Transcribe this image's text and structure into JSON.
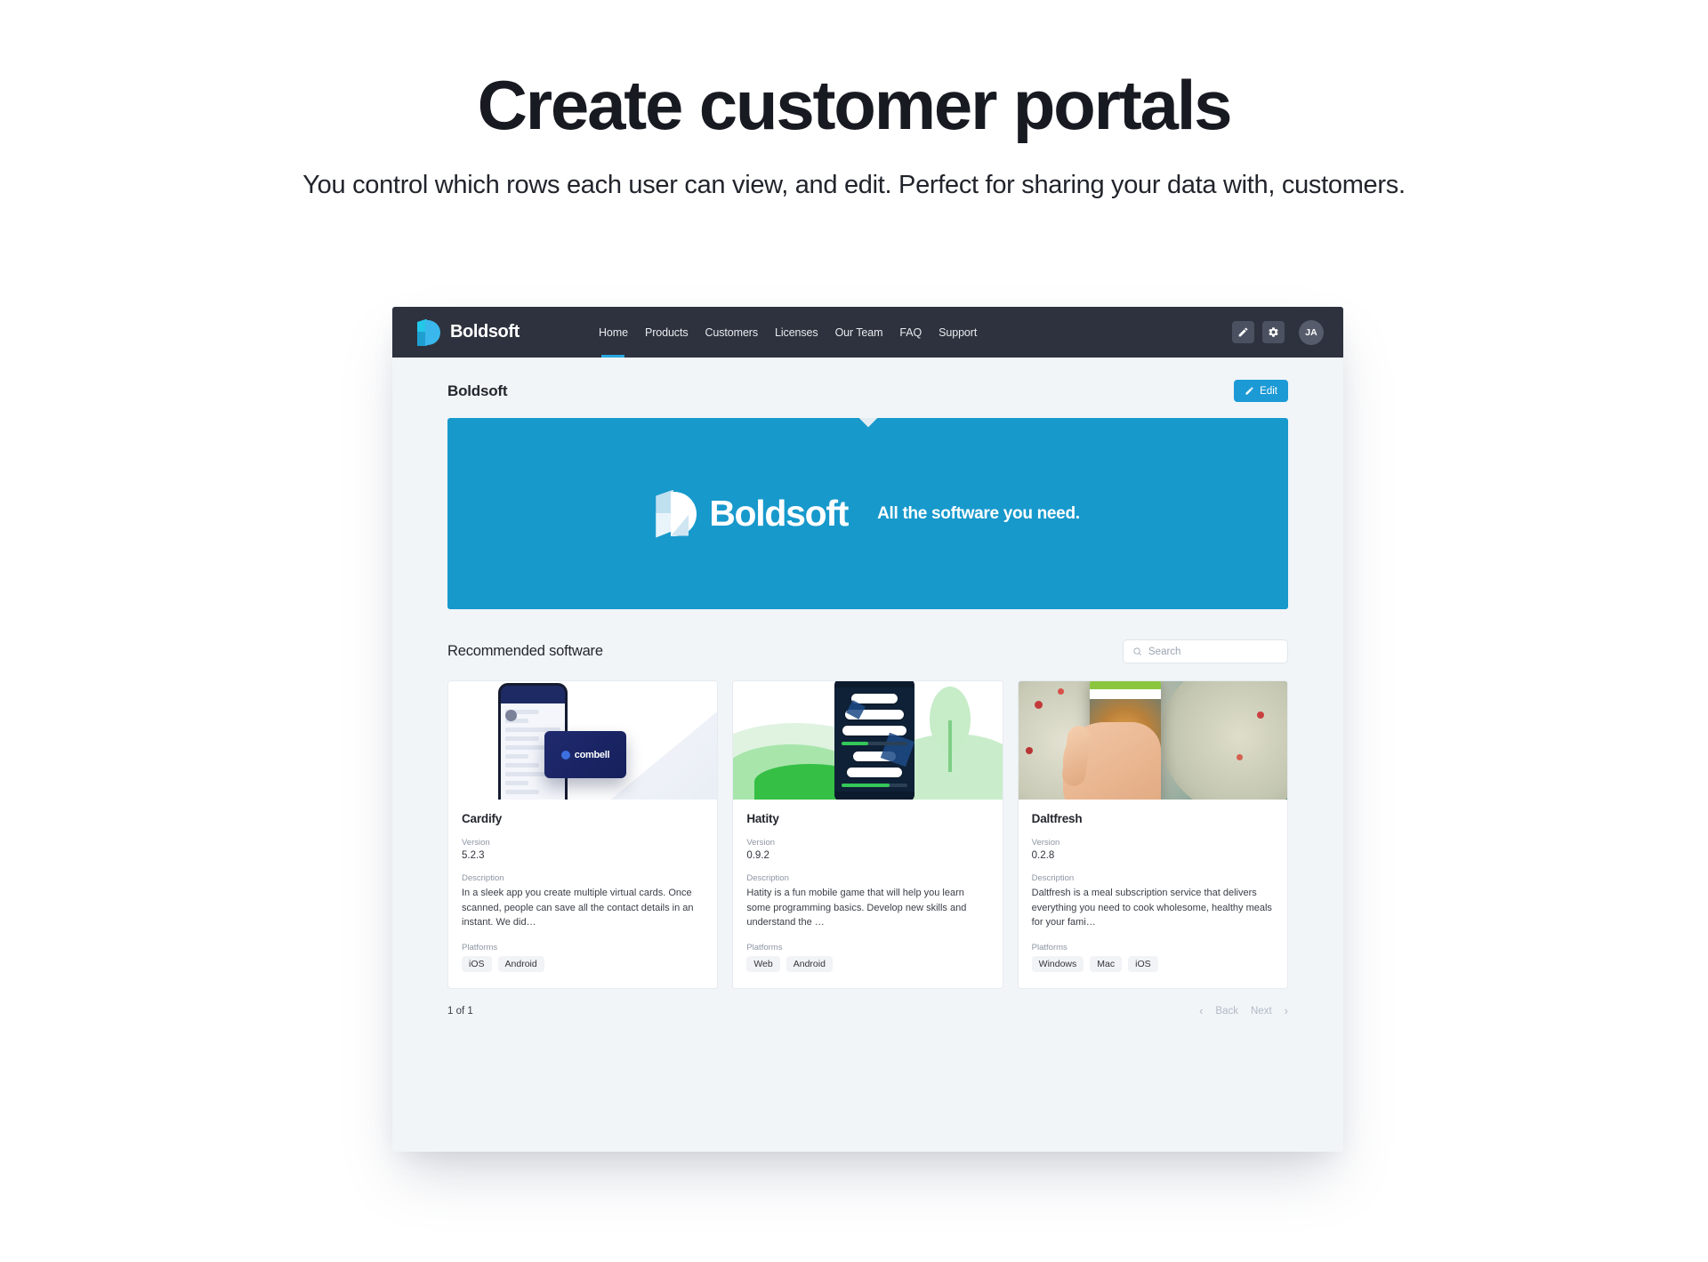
{
  "marketing": {
    "title": "Create customer portals",
    "subtitle": "You control which rows each user can view, and edit. Perfect for sharing your data with, customers."
  },
  "app": {
    "navbar": {
      "brand": "Boldsoft",
      "links": [
        {
          "label": "Home",
          "active": true
        },
        {
          "label": "Products",
          "active": false
        },
        {
          "label": "Customers",
          "active": false
        },
        {
          "label": "Licenses",
          "active": false
        },
        {
          "label": "Our Team",
          "active": false
        },
        {
          "label": "FAQ",
          "active": false
        },
        {
          "label": "Support",
          "active": false
        }
      ],
      "edit_icon": "pencil-icon",
      "settings_icon": "gear-icon",
      "avatar_initials": "JA"
    },
    "page": {
      "title": "Boldsoft",
      "edit_label": "Edit"
    },
    "banner": {
      "logo_text": "Boldsoft",
      "tagline": "All the software you need.",
      "color": "#1799cc"
    },
    "section": {
      "title": "Recommended software",
      "search_placeholder": "Search"
    },
    "field_labels": {
      "version": "Version",
      "description": "Description",
      "platforms": "Platforms"
    },
    "cards": [
      {
        "name": "Cardify",
        "version": "5.2.3",
        "description": "In a sleek app you create multiple virtual cards. Once scanned, people can save all the contact details in an instant. We did…",
        "platforms": [
          "iOS",
          "Android"
        ],
        "image_alt": "combell-phone-card-artwork"
      },
      {
        "name": "Hatity",
        "version": "0.9.2",
        "description": "Hatity is a fun mobile game that will help you learn some programming basics. Develop new skills and understand the …",
        "platforms": [
          "Web",
          "Android"
        ],
        "image_alt": "green-landscape-learning-app-artwork"
      },
      {
        "name": "Daltfresh",
        "version": "0.2.8",
        "description": "Daltfresh is a meal subscription service that delivers everything you need to cook wholesome, healthy meals for your fami…",
        "platforms": [
          "Windows",
          "Mac",
          "iOS"
        ],
        "image_alt": "meal-photo-phone-artwork"
      }
    ],
    "footer": {
      "count": "1 of 1",
      "back": "Back",
      "next": "Next",
      "prev_chevron": "‹",
      "next_chevron": "›"
    }
  }
}
